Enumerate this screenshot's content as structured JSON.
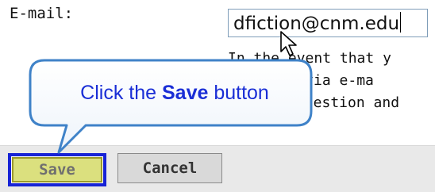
{
  "form": {
    "email_label": "E-mail:",
    "email_value": "dfiction@cnm.edu",
    "info_lines": [
      "In the event that y",
      "tion via e-ma",
      "question and"
    ]
  },
  "buttons": {
    "save_label": "Save",
    "cancel_label": "Cancel"
  },
  "callout": {
    "prefix": "Click the ",
    "emphasis": "Save",
    "suffix": " button"
  },
  "colors": {
    "callout_text": "#1a2ed6",
    "callout_border": "#3f82c8",
    "save_highlight": "#1723d6",
    "save_fill": "#dbe07e",
    "button_bar": "#e9e9e9"
  },
  "icons": {
    "cursor": "mouse-pointer-icon"
  }
}
